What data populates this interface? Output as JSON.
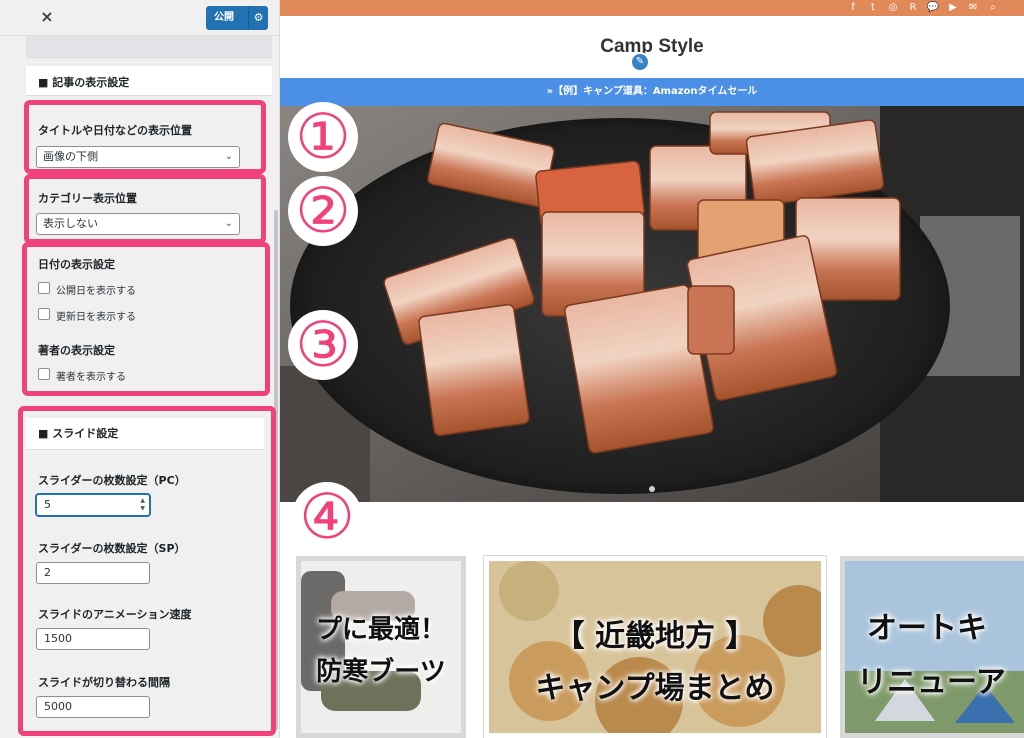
{
  "panel": {
    "close_icon": "×",
    "publish_label": "公開",
    "gear_icon": "⚙",
    "section_title": "■ 記事の表示設定",
    "title_position": {
      "label": "タイトルや日付などの表示位置",
      "value": "画像の下側"
    },
    "category_position": {
      "label": "カテゴリー表示位置",
      "value": "表示しない"
    },
    "date_settings": {
      "label": "日付の表示設定",
      "publish_date": "公開日を表示する",
      "updated_date": "更新日を表示する"
    },
    "author_settings": {
      "label": "著者の表示設定",
      "show_author": "著者を表示する"
    },
    "slide_title": "■ スライド設定",
    "slides_pc": {
      "label": "スライダーの枚数設定（PC）",
      "value": "5"
    },
    "slides_sp": {
      "label": "スライダーの枚数設定（SP）",
      "value": "2"
    },
    "animation_speed": {
      "label": "スライドのアニメーション速度",
      "value": "1500"
    },
    "interval": {
      "label": "スライドが切り替わる間隔",
      "value": "5000"
    }
  },
  "annotations": {
    "n1": "①",
    "n2": "②",
    "n3": "③",
    "n4": "④",
    "color": "#f0417a"
  },
  "preview": {
    "social_icons": [
      "f",
      "t",
      "◎",
      "R",
      "💬",
      "▶",
      "✉",
      "⌕"
    ],
    "site_title": "Camp Style",
    "pencil_icon": "✎",
    "notice": "»【例】キャンプ道具：Amazonタイムセール",
    "cards": [
      {
        "line1": "プに最適！",
        "line2": "防寒ブーツ"
      },
      {
        "line1": "【 近畿地方 】",
        "line2": "キャンプ場まとめ"
      },
      {
        "line1": "オートキ",
        "line2": "リニューア"
      }
    ]
  },
  "colors": {
    "accent_blue": "#2271b1",
    "topbar": "#e2895a",
    "notice": "#4b8fe6",
    "highlight": "#f0417a"
  }
}
